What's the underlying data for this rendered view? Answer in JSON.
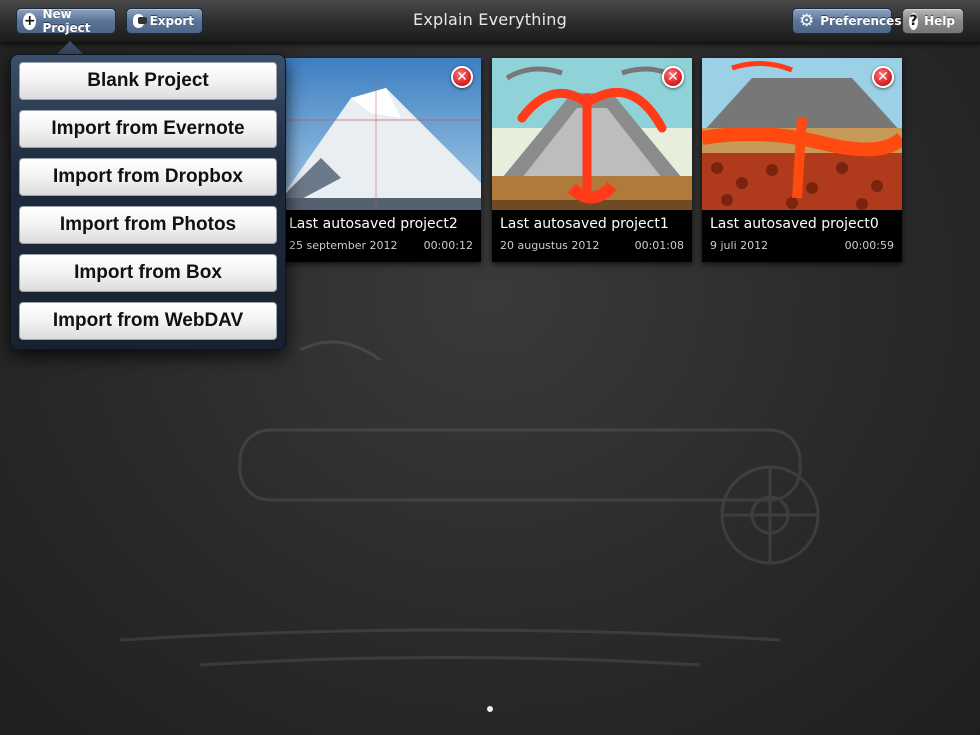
{
  "app": {
    "title": "Explain Everything"
  },
  "toolbar": {
    "new_project": "New Project",
    "export": "Export",
    "preferences": "Preferences",
    "help": "Help"
  },
  "new_project_menu": [
    "Blank Project",
    "Import from Evernote",
    "Import from Dropbox",
    "Import from Photos",
    "Import from Box",
    "Import from WebDAV"
  ],
  "projects": [
    {
      "title": "Last autosaved project2",
      "date": "25 september 2012",
      "duration": "00:00:12"
    },
    {
      "title": "Last autosaved project1",
      "date": "20 augustus 2012",
      "duration": "00:01:08"
    },
    {
      "title": "Last autosaved project0",
      "date": "9 juli 2012",
      "duration": "00:00:59"
    }
  ],
  "colors": {
    "toolbar_button": "#5b7497",
    "delete_badge": "#d8262a"
  },
  "pager": {
    "pages": 1,
    "current": 1
  }
}
